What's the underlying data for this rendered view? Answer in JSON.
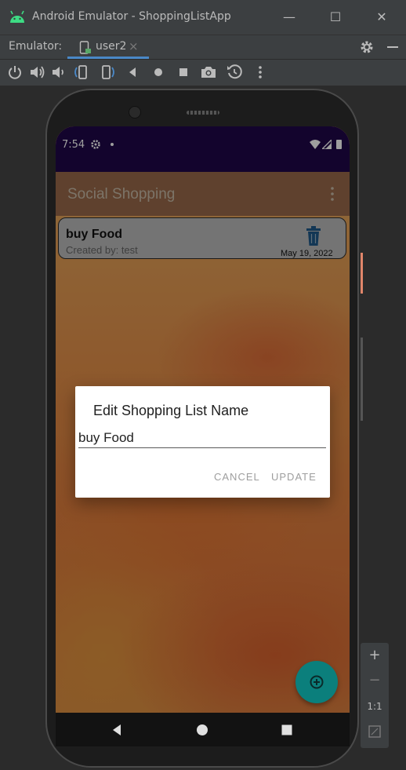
{
  "window": {
    "title": "Android Emulator - ShoppingListApp",
    "minimize": "—",
    "maximize": "☐",
    "close": "✕"
  },
  "tabbar": {
    "label": "Emulator:",
    "tab_name": "user2",
    "tab_close": "×"
  },
  "toolbar": {
    "icons": [
      "power-icon",
      "volume-up-icon",
      "volume-down-icon",
      "rotate-left-icon",
      "rotate-right-icon",
      "back-icon",
      "home-icon",
      "overview-icon",
      "camera-icon",
      "snapshot-icon",
      "more-icon"
    ]
  },
  "side_panel": {
    "zoom_in": "+",
    "zoom_out": "−",
    "one_to_one": "1:1"
  },
  "device": {
    "time": "7:54"
  },
  "app": {
    "title": "Social Shopping",
    "list_item": {
      "name": "buy Food",
      "created_by": "Created by: test",
      "date": "May 19, 2022"
    }
  },
  "dialog": {
    "title": "Edit Shopping List Name",
    "input_value": "buy Food",
    "cancel": "CANCEL",
    "update": "UPDATE"
  },
  "colors": {
    "status_bar": "#20074a",
    "fab": "#0b7f7c",
    "delete_icon": "#1f5a8a",
    "ide_bg": "#3c3f41"
  }
}
